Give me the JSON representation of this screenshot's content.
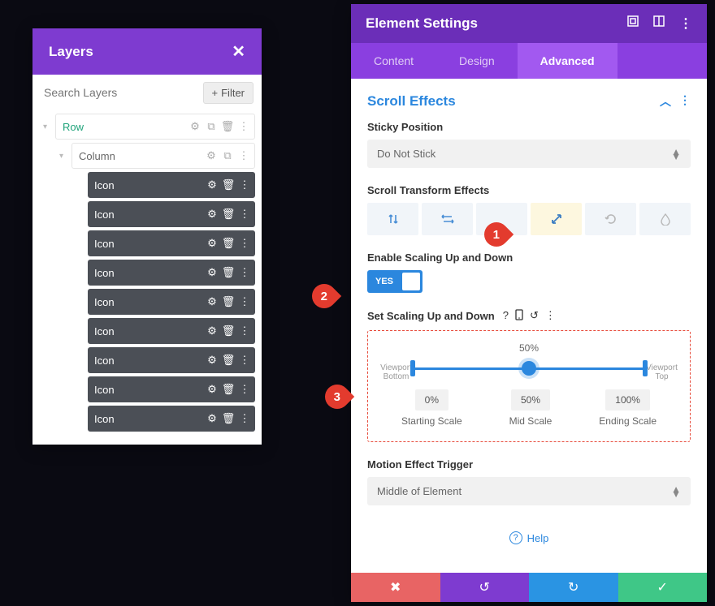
{
  "layers": {
    "title": "Layers",
    "search_placeholder": "Search Layers",
    "filter_label": "Filter",
    "row_label": "Row",
    "column_label": "Column",
    "icon_items": [
      "Icon",
      "Icon",
      "Icon",
      "Icon",
      "Icon",
      "Icon",
      "Icon",
      "Icon",
      "Icon"
    ]
  },
  "settings": {
    "title": "Element Settings",
    "tabs": {
      "content": "Content",
      "design": "Design",
      "advanced": "Advanced"
    },
    "section_title": "Scroll Effects",
    "sticky": {
      "label": "Sticky Position",
      "value": "Do Not Stick"
    },
    "transform_label": "Scroll Transform Effects",
    "enable": {
      "label": "Enable Scaling Up and Down",
      "yes": "YES"
    },
    "set_scaling_label": "Set Scaling Up and Down",
    "slider": {
      "mid_percent": "50%",
      "viewport_bottom": "Viewport Bottom",
      "viewport_top": "Viewport Top",
      "starting": {
        "value": "0%",
        "label": "Starting Scale"
      },
      "mid": {
        "value": "50%",
        "label": "Mid Scale"
      },
      "ending": {
        "value": "100%",
        "label": "Ending Scale"
      }
    },
    "trigger": {
      "label": "Motion Effect Trigger",
      "value": "Middle of Element"
    },
    "help": "Help"
  },
  "callouts": {
    "c1": "1",
    "c2": "2",
    "c3": "3"
  }
}
